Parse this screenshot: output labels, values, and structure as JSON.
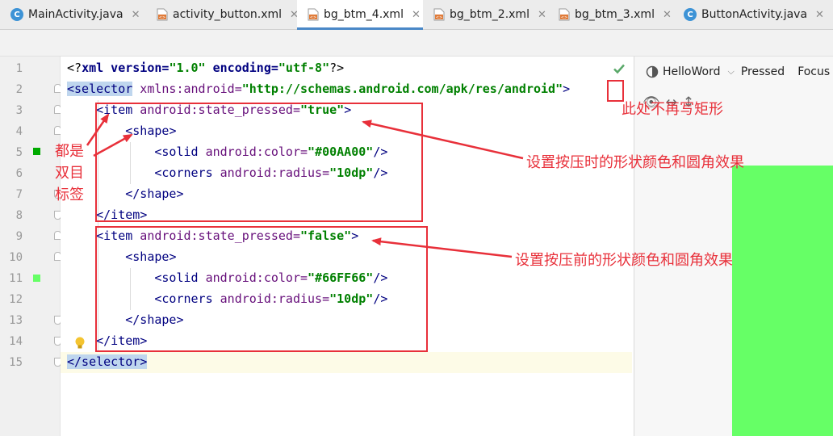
{
  "tabs": [
    {
      "label": "MainActivity.java",
      "icon": "java-class-icon",
      "active": false
    },
    {
      "label": "activity_button.xml",
      "icon": "xml-file-icon",
      "active": false
    },
    {
      "label": "bg_btm_4.xml",
      "icon": "xml-file-icon",
      "active": true
    },
    {
      "label": "bg_btm_2.xml",
      "icon": "xml-file-icon",
      "active": false
    },
    {
      "label": "bg_btm_3.xml",
      "icon": "xml-file-icon",
      "active": false
    },
    {
      "label": "ButtonActivity.java",
      "icon": "java-class-icon",
      "active": false
    }
  ],
  "tab_close_glyph": "✕",
  "line_numbers": [
    "1",
    "2",
    "3",
    "4",
    "5",
    "6",
    "7",
    "8",
    "9",
    "10",
    "11",
    "12",
    "13",
    "14",
    "15"
  ],
  "code": {
    "l1": {
      "open": "<?",
      "kw": "xml",
      "a1": " version=",
      "s1": "\"1.0\"",
      "a2": " encoding=",
      "s2": "\"utf-8\"",
      "close": "?>"
    },
    "l2": {
      "tag": "<selector",
      "attr": " xmlns:android=",
      "str": "\"http://schemas.android.com/apk/res/android\"",
      "close": ">"
    },
    "l3": {
      "tag": "<item",
      "attr": " android:state_pressed=",
      "str": "\"true\"",
      "close": ">"
    },
    "l4": {
      "tag": "<shape",
      "close": ">"
    },
    "l5": {
      "tag": "<solid",
      "attr": " android:color=",
      "str": "\"#00AA00\"",
      "close": "/>"
    },
    "l6": {
      "tag": "<corners",
      "attr": " android:radius=",
      "str": "\"10dp\"",
      "close": "/>"
    },
    "l7": {
      "tag": "</shape",
      "close": ">"
    },
    "l8": {
      "tag": "</item",
      "close": ">"
    },
    "l9": {
      "tag": "<item",
      "attr": " android:state_pressed=",
      "str": "\"false\"",
      "close": ">"
    },
    "l10": {
      "tag": "<shape",
      "close": ">"
    },
    "l11": {
      "tag": "<solid",
      "attr": " android:color=",
      "str": "\"#66FF66\"",
      "close": "/>"
    },
    "l12": {
      "tag": "<corners",
      "attr": " android:radius=",
      "str": "\"10dp\"",
      "close": "/>"
    },
    "l13": {
      "tag": "</shape",
      "close": ">"
    },
    "l14": {
      "tag": "</item",
      "close": ">"
    },
    "l15": {
      "tag": "</selector",
      "close": ">"
    }
  },
  "gutter_colors": {
    "pressed": "#00AA00",
    "normal": "#66FF66"
  },
  "preview": {
    "device": "HelloWord",
    "state": "Pressed",
    "focus": "Focus",
    "preview_color": "#66FF66"
  },
  "annotations": {
    "no_rect": "此处不再写矩形",
    "pressed_note": "设置按压时的形状颜色和圆角效果",
    "unpressed_note": "设置按压前的形状颜色和圆角效果",
    "double_tag_line1": "都是",
    "double_tag_line2": "双目",
    "double_tag_line3": "标签"
  },
  "accent_colors": {
    "annotation": "#E8303A",
    "active_tab": "#4A88C7",
    "check": "#59A869"
  }
}
